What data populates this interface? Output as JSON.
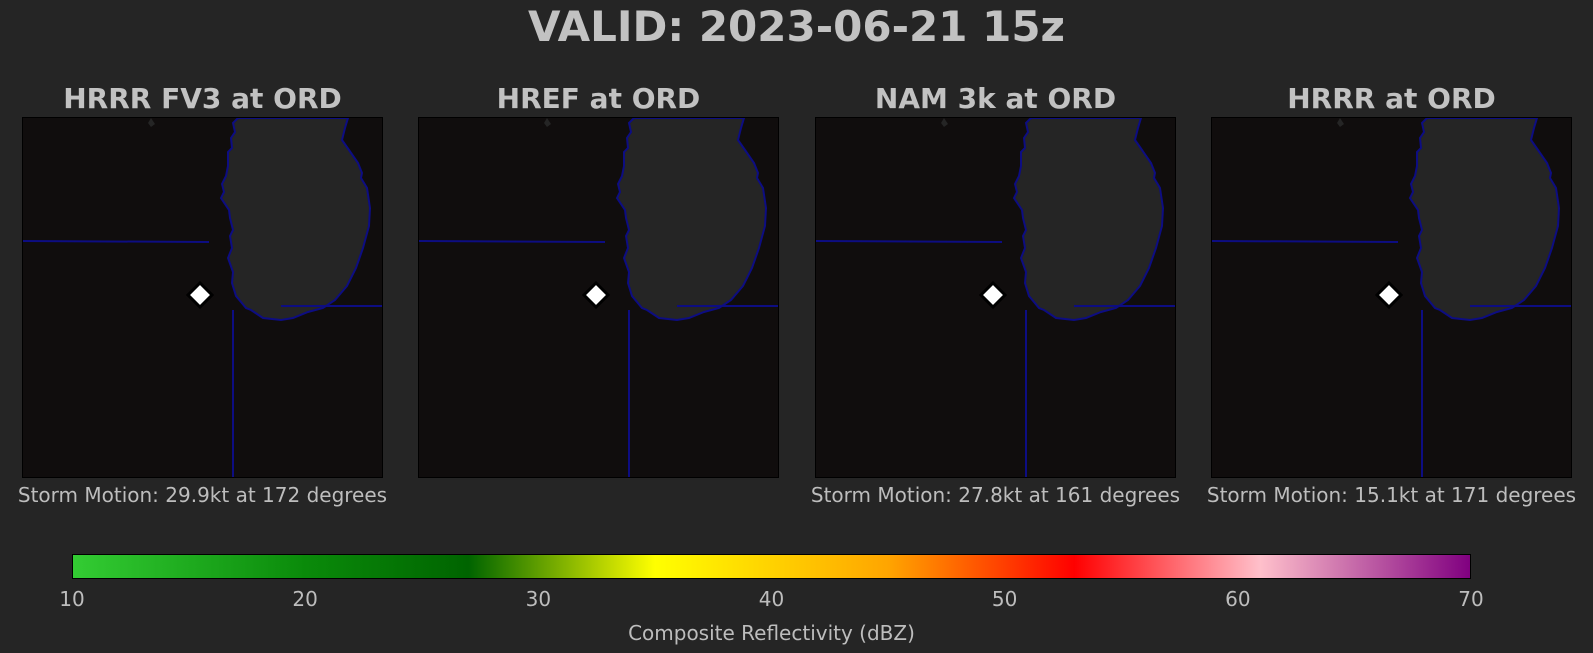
{
  "title": "VALID: 2023-06-21 15z",
  "panels": [
    {
      "title": "HRRR FV3 at ORD",
      "storm_motion": "Storm Motion: 29.9kt at 172 degrees"
    },
    {
      "title": "HREF at ORD",
      "storm_motion": ""
    },
    {
      "title": "NAM 3k at ORD",
      "storm_motion": "Storm Motion: 27.8kt at 161 degrees"
    },
    {
      "title": "HRRR at ORD",
      "storm_motion": "Storm Motion: 15.1kt at 171 degrees"
    }
  ],
  "map": {
    "station_marker": "diamond-marker",
    "colors": {
      "land": "#100d0d",
      "lake": "#252525",
      "borders": "#0d0d82",
      "station": "#ffffff"
    }
  },
  "colorbar": {
    "label": "Composite Reflectivity (dBZ)",
    "ticks": [
      "10",
      "20",
      "30",
      "40",
      "50",
      "60",
      "70"
    ],
    "range": [
      10,
      70
    ],
    "stops": [
      {
        "value": 10,
        "color": "#33cc33"
      },
      {
        "value": 20,
        "color": "#0a8a0a"
      },
      {
        "value": 27,
        "color": "#006400"
      },
      {
        "value": 35,
        "color": "#ffff00"
      },
      {
        "value": 45,
        "color": "#ffa500"
      },
      {
        "value": 53,
        "color": "#ff0000"
      },
      {
        "value": 61,
        "color": "#ffc0cb"
      },
      {
        "value": 70,
        "color": "#800080"
      }
    ]
  }
}
